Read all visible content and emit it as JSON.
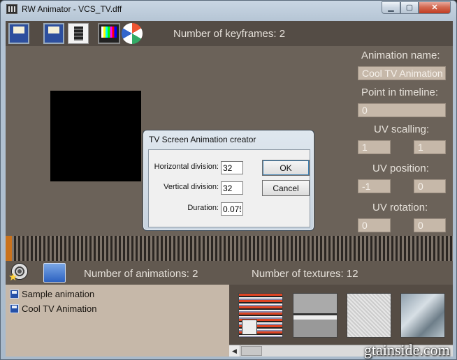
{
  "window": {
    "title": "RW Animator - VCS_TV.dff",
    "close_glyph": "✕"
  },
  "toolbar": {
    "keyframes_label": "Number of keyframes: 2"
  },
  "right_panel": {
    "animation_name_label": "Animation name:",
    "animation_name_value": "Cool TV Animation",
    "point_label": "Point in timeline:",
    "point_value": "0",
    "uv_scaling_label": "UV scalling:",
    "uv_scaling_u": "1",
    "uv_scaling_v": "1",
    "uv_position_label": "UV position:",
    "uv_position_u": "-1",
    "uv_position_v": "0",
    "uv_rotation_label": "UV rotation:",
    "uv_rotation_u": "0",
    "uv_rotation_v": "0"
  },
  "bottom_bar": {
    "animations_count": "Number of animations: 2",
    "textures_count": "Number of textures: 12"
  },
  "animations": [
    {
      "label": "Sample animation"
    },
    {
      "label": "Cool TV Animation"
    }
  ],
  "dialog": {
    "title": "TV Screen Animation creator",
    "horizontal_label": "Horizontal division:",
    "horizontal_value": "32",
    "vertical_label": "Vertical division:",
    "vertical_value": "32",
    "duration_label": "Duration:",
    "duration_value": "0.075",
    "ok_label": "OK",
    "cancel_label": "Cancel"
  },
  "watermark": "gtainside.com",
  "colors": {
    "panel": "#6b6259",
    "field": "#c6b8a9",
    "timeline_cursor": "#c9721d"
  }
}
